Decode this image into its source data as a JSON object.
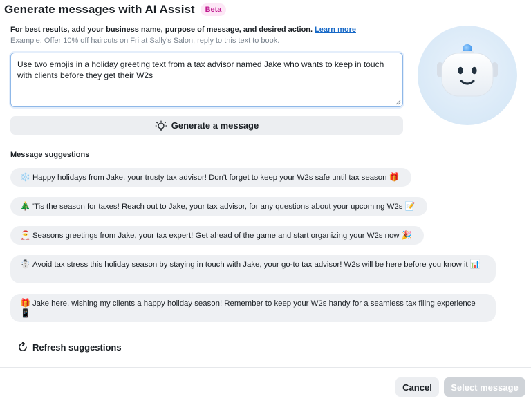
{
  "dialog": {
    "title": "Generate messages with AI Assist",
    "badge": "Beta"
  },
  "instructions": {
    "text": "For best results, add your business name, purpose of message, and desired action.",
    "link": "Learn more",
    "example": "Example: Offer 10% off haircuts on Fri at Sally's Salon, reply to this text to book."
  },
  "prompt": {
    "value": "Use two emojis in a holiday greeting text from a tax advisor named Jake who wants to keep in touch with clients before they get their W2s"
  },
  "generate_button": {
    "icon": "lightbulb-icon",
    "label": "Generate a message"
  },
  "suggestions": {
    "label": "Message suggestions",
    "items": [
      {
        "emoji": "❄️",
        "text": "Happy holidays from Jake, your trusty tax advisor! Don't forget to keep your W2s safe until tax season",
        "trail_emoji": "🎁"
      },
      {
        "emoji": "🎄",
        "text": "'Tis the season for taxes! Reach out to Jake, your tax advisor, for any questions about your upcoming W2s",
        "trail_emoji": "📝"
      },
      {
        "emoji": "🎅",
        "text": "Seasons greetings from Jake, your tax expert! Get ahead of the game and start organizing your W2s now",
        "trail_emoji": "🎉"
      },
      {
        "emoji": "☃️",
        "text": "Avoid tax stress this holiday season by staying in touch with Jake, your go-to tax advisor! W2s will be here before you know it",
        "trail_emoji": "📊"
      },
      {
        "emoji": "🎁",
        "text": "Jake here, wishing my clients a happy holiday season! Remember to keep your W2s handy for a seamless tax filing experience",
        "trail_emoji": "📱"
      }
    ]
  },
  "refresh": {
    "icon": "refresh-icon",
    "label": "Refresh suggestions"
  },
  "footer": {
    "cancel_label": "Cancel",
    "select_label": "Select message"
  },
  "colors": {
    "beta_bg": "#fde7f6",
    "beta_text": "#c0198f",
    "link": "#1769c7",
    "suggestion_bg": "#eef0f3",
    "disabled_button": "#cfd3d8"
  }
}
